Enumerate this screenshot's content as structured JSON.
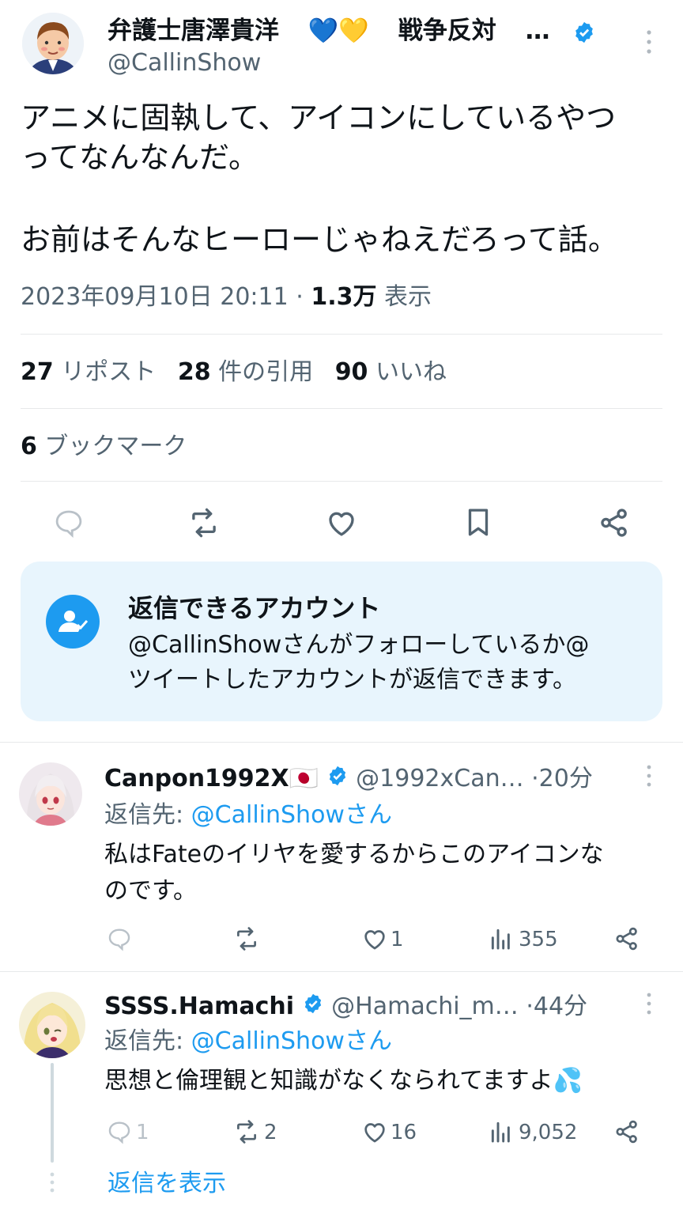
{
  "tweet": {
    "author_name": "弁護士唐澤貴洋",
    "author_emoji": "💙💛",
    "author_tag": "戦争反対",
    "author_ellipsis": "…",
    "author_handle": "@CallinShow",
    "text_line1": "アニメに固執して、アイコンにしているやつ",
    "text_line2": "ってなんなんだ。",
    "text_line3": "お前はそんなヒーローじゃねえだろって話。",
    "timestamp": "2023年09月10日 20:11",
    "separator": "·",
    "views": "1.3万",
    "views_label": "表示",
    "reposts_count": "27",
    "reposts_label": "リポスト",
    "quotes_count": "28",
    "quotes_label": "件の引用",
    "likes_count": "90",
    "likes_label": "いいね",
    "bookmarks_count": "6",
    "bookmarks_label": "ブックマーク"
  },
  "reply_restriction": {
    "title": "返信できるアカウント",
    "line1": "@CallinShowさんがフォローしているか@",
    "line2": "ツイートしたアカウントが返信できます。"
  },
  "replies": [
    {
      "name": "Canpon1992X🇯🇵",
      "handle": "@1992xCan…",
      "time": "·20分",
      "reply_to_label": "返信先:",
      "reply_to_user": "@CallinShowさん",
      "text_line1": "私はFateのイリヤを愛するからこのアイコンな",
      "text_line2": "のです。",
      "replies": "",
      "reposts": "",
      "likes": "1",
      "views": "355"
    },
    {
      "name": "SSSS.Hamachi",
      "handle": "@Hamachi_m…",
      "time": "·44分",
      "reply_to_label": "返信先:",
      "reply_to_user": "@CallinShowさん",
      "text_line1": "思想と倫理観と知識がなくなられてますよ💦",
      "replies": "1",
      "reposts": "2",
      "likes": "16",
      "views": "9,052"
    }
  ],
  "show_replies": "返信を表示",
  "colors": {
    "accent": "#1d9bf0",
    "muted": "#536471",
    "divider": "#e7e9ea",
    "card_bg": "#e8f5fd"
  }
}
